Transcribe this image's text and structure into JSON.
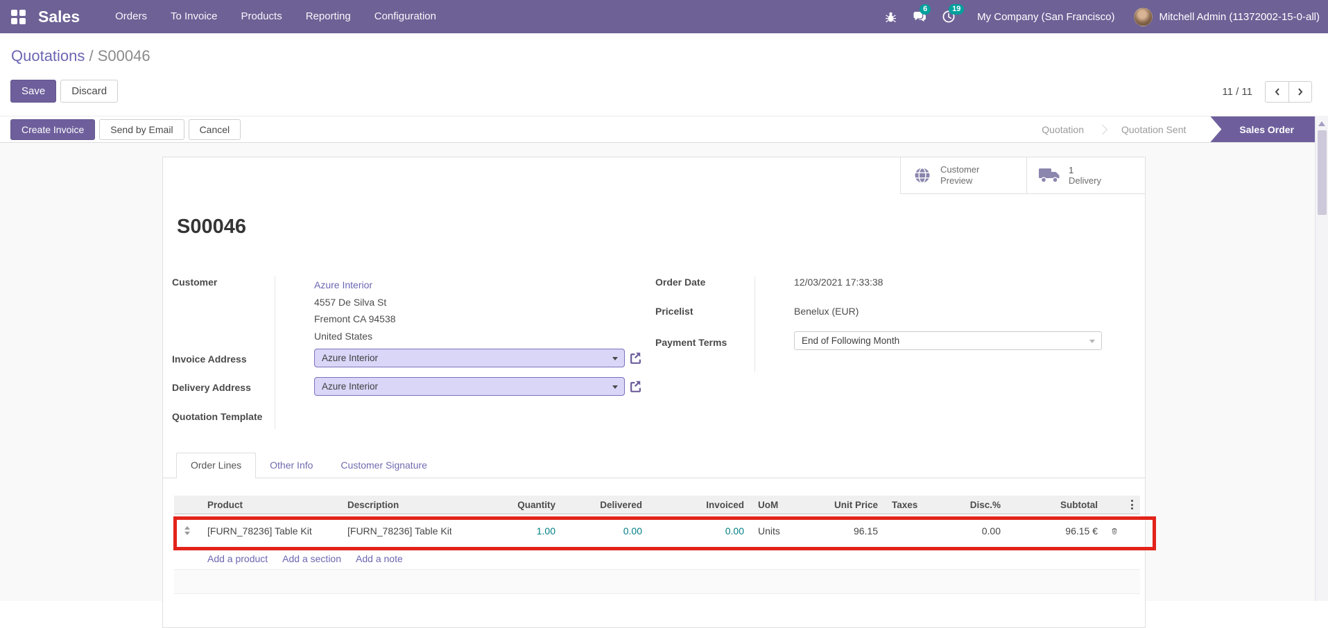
{
  "navbar": {
    "brand": "Sales",
    "menus": [
      "Orders",
      "To Invoice",
      "Products",
      "Reporting",
      "Configuration"
    ],
    "messages_badge": "6",
    "activities_badge": "19",
    "company": "My Company (San Francisco)",
    "user": "Mitchell Admin (11372002-15-0-all)"
  },
  "breadcrumb": {
    "parent": "Quotations",
    "separator": " / ",
    "current": "S00046"
  },
  "control_panel": {
    "save": "Save",
    "discard": "Discard",
    "pager": "11 / 11"
  },
  "statusbar": {
    "create_invoice": "Create Invoice",
    "send_by_email": "Send by Email",
    "cancel": "Cancel",
    "stages": [
      {
        "label": "Quotation",
        "active": false
      },
      {
        "label": "Quotation Sent",
        "active": false
      },
      {
        "label": "Sales Order",
        "active": true
      }
    ]
  },
  "smart_buttons": {
    "customer_preview": {
      "label": "Customer Preview",
      "icon": "globe-icon"
    },
    "delivery": {
      "value": "1",
      "label": "Delivery",
      "icon": "truck-icon"
    }
  },
  "form": {
    "title": "S00046",
    "customer": {
      "label": "Customer",
      "name": "Azure Interior",
      "address_lines": [
        "4557 De Silva St",
        "Fremont CA 94538",
        "United States"
      ]
    },
    "invoice_address": {
      "label": "Invoice Address",
      "value": "Azure Interior"
    },
    "delivery_address": {
      "label": "Delivery Address",
      "value": "Azure Interior"
    },
    "quotation_template": {
      "label": "Quotation Template",
      "value": ""
    },
    "order_date": {
      "label": "Order Date",
      "value": "12/03/2021 17:33:38"
    },
    "pricelist": {
      "label": "Pricelist",
      "value": "Benelux (EUR)"
    },
    "payment_terms": {
      "label": "Payment Terms",
      "value": "End of Following Month"
    }
  },
  "tabs": [
    {
      "label": "Order Lines",
      "active": true
    },
    {
      "label": "Other Info",
      "active": false
    },
    {
      "label": "Customer Signature",
      "active": false
    }
  ],
  "order_lines": {
    "headers": {
      "product": "Product",
      "description": "Description",
      "quantity": "Quantity",
      "delivered": "Delivered",
      "invoiced": "Invoiced",
      "uom": "UoM",
      "unit_price": "Unit Price",
      "taxes": "Taxes",
      "disc": "Disc.%",
      "subtotal": "Subtotal"
    },
    "rows": [
      {
        "product": "[FURN_78236] Table Kit",
        "description": "[FURN_78236] Table Kit",
        "quantity": "1.00",
        "delivered": "0.00",
        "invoiced": "0.00",
        "uom": "Units",
        "unit_price": "96.15",
        "taxes": "",
        "disc": "0.00",
        "subtotal": "96.15 €"
      }
    ],
    "add_links": [
      "Add a product",
      "Add a section",
      "Add a note"
    ]
  },
  "annotation": {
    "type": "highlight-box",
    "target": "order-line-row",
    "color": "#e2231a"
  },
  "colors": {
    "navbar_bg": "#6e6196",
    "primary_button": "#6e5f9c",
    "link": "#6b66b2",
    "badge": "#00a09d",
    "numeric_teal": "#017e84",
    "field_bg_lavender": "#d9d6f8"
  }
}
